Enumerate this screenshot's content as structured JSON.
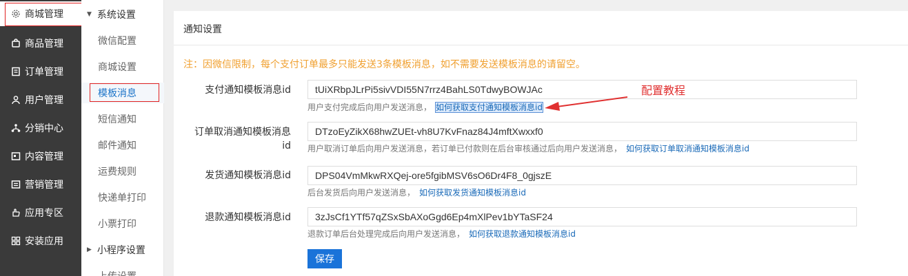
{
  "sidebar": {
    "items": [
      {
        "label": "商城管理",
        "icon": "gear-icon"
      },
      {
        "label": "商品管理",
        "icon": "bag-icon"
      },
      {
        "label": "订单管理",
        "icon": "order-icon"
      },
      {
        "label": "用户管理",
        "icon": "user-icon"
      },
      {
        "label": "分销中心",
        "icon": "network-icon"
      },
      {
        "label": "内容管理",
        "icon": "content-icon"
      },
      {
        "label": "营销管理",
        "icon": "marketing-icon"
      },
      {
        "label": "应用专区",
        "icon": "hand-icon"
      },
      {
        "label": "安装应用",
        "icon": "grid-icon"
      }
    ]
  },
  "submenu": {
    "group1": "系统设置",
    "items": [
      "微信配置",
      "商城设置",
      "模板消息",
      "短信通知",
      "邮件通知",
      "运费规则",
      "快递单打印",
      "小票打印"
    ],
    "group2": "小程序设置",
    "cut_item": "上传设置"
  },
  "panel": {
    "title": "通知设置",
    "notice": "注：因微信限制，每个支付订单最多只能发送3条模板消息，如不需要发送模板消息的请留空。"
  },
  "fields": [
    {
      "label": "支付通知模板消息id",
      "value": "tUiXRbpJLrPi5sivVDI55N7rrz4BahLS0TdwyBOWJAc",
      "help": "用户支付完成后向用户发送消息，",
      "link": "如何获取支付通知模板消息id"
    },
    {
      "label_line1": "订单取消通知模板消息",
      "label_line2": "id",
      "value": "DTzoEyZikX68hwZUEt-vh8U7KvFnaz84J4mftXwxxf0",
      "help": "用户取消订单后向用户发送消息，若订单已付款则在后台审核通过后向用户发送消息，",
      "link": "如何获取订单取消通知模板消息id"
    },
    {
      "label": "发货通知模板消息id",
      "value": "DPS04VmMkwRXQej-ore5fgibMSV6sO6Dr4F8_0gjszE",
      "help": "后台发货后向用户发送消息，",
      "link": "如何获取发货通知模板消息id"
    },
    {
      "label": "退款通知模板消息id",
      "value": "3zJsCf1YTf57qZSxSbAXoGgd6Ep4mXlPev1bYTaSF24",
      "help": "退款订单后台处理完成后向用户发送消息，",
      "link": "如何获取退款通知模板消息id"
    }
  ],
  "save_label": "保存",
  "annotation": "配置教程",
  "colors": {
    "sidebar_bg": "#3a3a3a",
    "accent_blue": "#1a73d9",
    "notice_orange": "#f0a030",
    "annotation_red": "#e03030"
  }
}
